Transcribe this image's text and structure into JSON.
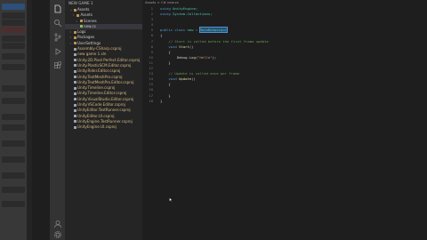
{
  "colors": {
    "accent": "#0e639c",
    "folder": "#c09553",
    "csfile": "#8fbf5a",
    "meta": "#9da5b4"
  },
  "explorer": {
    "header": "NEW GAME 1",
    "items": [
      {
        "label": "Assets",
        "chev": "v",
        "indent": 1,
        "icon": "folder-icon"
      },
      {
        "label": "Assets",
        "chev": ">",
        "indent": 2,
        "icon": "folder-icon"
      },
      {
        "label": "Scenes",
        "chev": ">",
        "indent": 3,
        "icon": "folder-icon"
      },
      {
        "label": "new.cs",
        "chev": "",
        "indent": 3,
        "icon": "csharp-file-icon",
        "selected": true
      },
      {
        "label": "Logs",
        "chev": ">",
        "indent": 1,
        "icon": "folder-icon"
      },
      {
        "label": "Packages",
        "chev": ">",
        "indent": 1,
        "icon": "folder-icon"
      },
      {
        "label": "UserSettings",
        "chev": ">",
        "indent": 1,
        "icon": "folder-icon"
      },
      {
        "label": "Assembly-CSharp.csproj",
        "chev": "",
        "indent": 1,
        "icon": "file-icon"
      },
      {
        "label": "new game 1.sln",
        "chev": "",
        "indent": 1,
        "icon": "file-icon"
      },
      {
        "label": "Unity.2D.Pixel Perfect.Editor.csproj",
        "chev": "",
        "indent": 1,
        "icon": "file-icon"
      },
      {
        "label": "Unity.PlasticSCM.Editor.csproj",
        "chev": "",
        "indent": 1,
        "icon": "file-icon"
      },
      {
        "label": "Unity.Rider.Editor.csproj",
        "chev": "",
        "indent": 1,
        "icon": "file-icon"
      },
      {
        "label": "Unity.TextMeshPro.csproj",
        "chev": "",
        "indent": 1,
        "icon": "file-icon"
      },
      {
        "label": "Unity.TextMeshPro.Editor.csproj",
        "chev": "",
        "indent": 1,
        "icon": "file-icon"
      },
      {
        "label": "Unity.Timeline.csproj",
        "chev": "",
        "indent": 1,
        "icon": "file-icon"
      },
      {
        "label": "Unity.Timeline.Editor.csproj",
        "chev": "",
        "indent": 1,
        "icon": "file-icon"
      },
      {
        "label": "Unity.VisualStudio.Editor.csproj",
        "chev": "",
        "indent": 1,
        "icon": "file-icon"
      },
      {
        "label": "Unity.VSCode.Editor.csproj",
        "chev": "",
        "indent": 1,
        "icon": "file-icon"
      },
      {
        "label": "UnityEditor.TestRunner.csproj",
        "chev": "",
        "indent": 1,
        "icon": "file-icon"
      },
      {
        "label": "UnityEditor.UI.csproj",
        "chev": "",
        "indent": 1,
        "icon": "file-icon"
      },
      {
        "label": "UnityEngine.TestRunner.csproj",
        "chev": "",
        "indent": 1,
        "icon": "file-icon"
      },
      {
        "label": "UnityEngine.UI.csproj",
        "chev": "",
        "indent": 1,
        "icon": "file-icon"
      }
    ]
  },
  "editor": {
    "breadcrumb": "Assets > C# new.cs",
    "lines": [
      [
        {
          "t": "using ",
          "c": "kw"
        },
        {
          "t": "UnityEngine;",
          "c": "ty"
        }
      ],
      [
        {
          "t": "using ",
          "c": "kw"
        },
        {
          "t": "System.Collections;",
          "c": "ty"
        }
      ],
      [],
      [],
      [
        {
          "t": "public class ",
          "c": "kw"
        },
        {
          "t": "new ",
          "c": "ty"
        },
        {
          "t": ": ",
          "c": "pl"
        },
        {
          "t": "MonoBehaviour",
          "c": "ty",
          "hl": true
        }
      ],
      [
        {
          "t": "{",
          "c": "pl"
        }
      ],
      [
        {
          "t": "    // Start is called before the first frame update",
          "c": "cm"
        }
      ],
      [
        {
          "t": "    void ",
          "c": "kw"
        },
        {
          "t": "Start",
          "c": "fn"
        },
        {
          "t": "()",
          "c": "pl"
        }
      ],
      [
        {
          "t": "    {",
          "c": "pl"
        }
      ],
      [
        {
          "t": "        Debug.",
          "c": "pl"
        },
        {
          "t": "Log",
          "c": "fn"
        },
        {
          "t": "(",
          "c": "pl"
        },
        {
          "t": "\"Hello\"",
          "c": "st"
        },
        {
          "t": ");",
          "c": "pl"
        }
      ],
      [
        {
          "t": "    }",
          "c": "pl"
        }
      ],
      [],
      [
        {
          "t": "    // Update is called once per frame",
          "c": "cm"
        }
      ],
      [
        {
          "t": "    void ",
          "c": "kw"
        },
        {
          "t": "Update",
          "c": "fn"
        },
        {
          "t": "()",
          "c": "pl"
        }
      ],
      [
        {
          "t": "    {",
          "c": "pl"
        }
      ],
      [
        {
          "t": "        ",
          "c": "pl"
        }
      ],
      [
        {
          "t": "    }",
          "c": "pl"
        }
      ],
      [
        {
          "t": "}",
          "c": "pl"
        }
      ]
    ]
  }
}
